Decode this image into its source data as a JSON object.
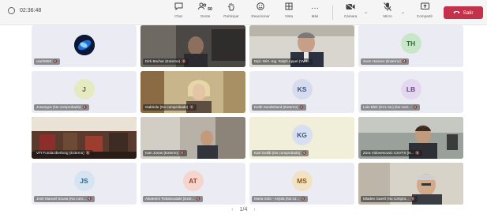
{
  "call_timer": "02:36:48",
  "toolbar": {
    "chat": {
      "label": "Chat",
      "icon": "chat-icon"
    },
    "people": {
      "label": "Gente",
      "count": "50",
      "icon": "people-icon"
    },
    "raise": {
      "label": "Participar",
      "icon": "raise-hand-icon"
    },
    "react": {
      "label": "Reaccionar",
      "icon": "react-icon"
    },
    "view": {
      "label": "Vista",
      "icon": "view-icon"
    },
    "more": {
      "label": "Más",
      "icon": "more-icon"
    },
    "camera": {
      "label": "Cámara",
      "icon": "camera-icon"
    },
    "mic": {
      "label": "Micro",
      "icon": "mic-icon"
    },
    "share": {
      "label": "Compartir",
      "icon": "share-icon"
    },
    "leave": {
      "label": "Salir",
      "icon": "phone-icon",
      "color": "#c4314b"
    }
  },
  "tiles": [
    {
      "name": "user9650",
      "type": "avatar-image"
    },
    {
      "name": "Dirk Bochar (Externo)",
      "type": "video"
    },
    {
      "name": "Dipl.-Wirt.-Ing. Ralph Appel (VWI...",
      "type": "video"
    },
    {
      "name": "Sven Hansen (Externo)",
      "type": "initials",
      "initials": "TH",
      "avatar_bg": "#c8e6c9",
      "avatar_fg": "#2e6b3a"
    },
    {
      "name": "Josangus (No comprobado)",
      "type": "initials",
      "initials": "J",
      "avatar_bg": "#e5eac0",
      "avatar_fg": "#5b6420"
    },
    {
      "name": "Gabriele (No comprobado)",
      "type": "video"
    },
    {
      "name": "Keith Sunderland (Externo)",
      "type": "initials",
      "initials": "KS",
      "avatar_bg": "#d6dcee",
      "avatar_fg": "#3c4f86"
    },
    {
      "name": "Lois Blek (KVL NL) (No com...",
      "type": "initials",
      "initials": "LB",
      "avatar_bg": "#e4d8ee",
      "avatar_fg": "#6b3f8c"
    },
    {
      "name": "VFI Fundaciberborg (Externo)",
      "type": "video"
    },
    {
      "name": "Ivan Jonas (Externo)",
      "type": "video"
    },
    {
      "name": "Karl Gotlib (No comprobado)",
      "type": "initials",
      "initials": "KG",
      "avatar_bg": "#d7dff0",
      "avatar_fg": "#3a5584"
    },
    {
      "name": "Zora Vidovencovic CSVTS (N...",
      "type": "video"
    },
    {
      "name": "José Manuel Sousa (No com...",
      "type": "initials",
      "initials": "JS",
      "avatar_bg": "#d6e4f2",
      "avatar_fg": "#2f5f8f"
    },
    {
      "name": "Aikaterini Tsikakoudaki (Exte...",
      "type": "initials",
      "initials": "AT",
      "avatar_bg": "#f4d6cf",
      "avatar_fg": "#a33b2a"
    },
    {
      "name": "Maria Solo - Anjola (No co...",
      "type": "initials",
      "initials": "MS",
      "avatar_bg": "#f2e2c4",
      "avatar_fg": "#8a5a14"
    },
    {
      "name": "Mladen Gaertl (No compro...",
      "type": "video"
    }
  ],
  "pagination": {
    "prev": "‹",
    "page": "1/4",
    "next": "›"
  }
}
